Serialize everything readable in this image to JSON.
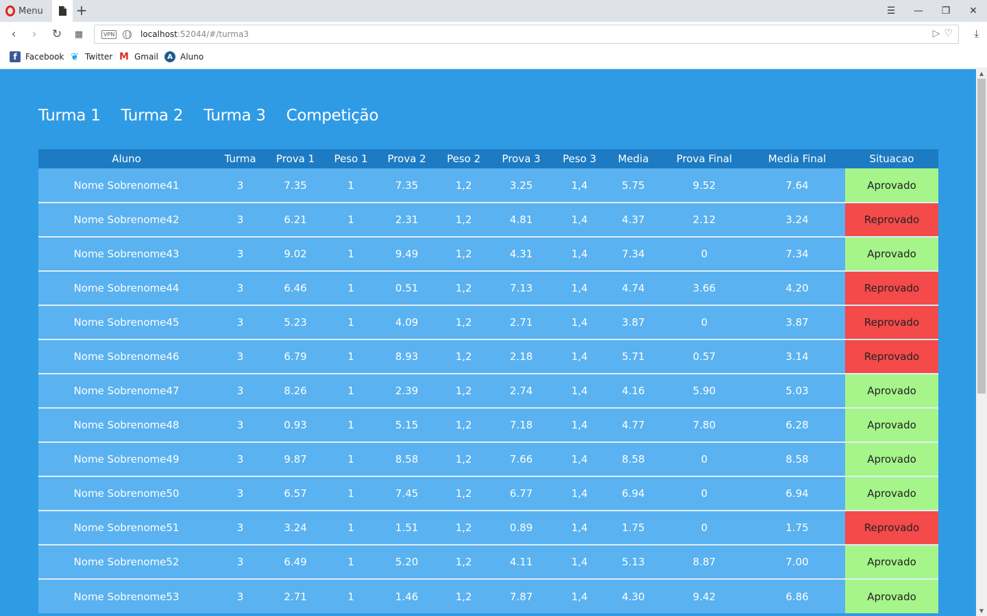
{
  "browser": {
    "menu_label": "Menu",
    "url_host": "localhost",
    "url_rest": ":52044/#/turma3",
    "vpn_label": "VPN",
    "bookmarks": [
      {
        "label": "Facebook",
        "icon": "facebook-icon"
      },
      {
        "label": "Twitter",
        "icon": "twitter-icon"
      },
      {
        "label": "Gmail",
        "icon": "gmail-icon"
      },
      {
        "label": "Aluno",
        "icon": "aluno-icon"
      }
    ]
  },
  "nav": {
    "items": [
      "Turma 1",
      "Turma 2",
      "Turma 3",
      "Competição"
    ]
  },
  "table": {
    "headers": [
      "Aluno",
      "Turma",
      "Prova 1",
      "Peso 1",
      "Prova 2",
      "Peso 2",
      "Prova 3",
      "Peso 3",
      "Media",
      "Prova Final",
      "Media Final",
      "Situacao"
    ],
    "rows": [
      [
        "Nome Sobrenome41",
        "3",
        "7.35",
        "1",
        "7.35",
        "1,2",
        "3.25",
        "1,4",
        "5.75",
        "9.52",
        "7.64",
        "Aprovado"
      ],
      [
        "Nome Sobrenome42",
        "3",
        "6.21",
        "1",
        "2.31",
        "1,2",
        "4.81",
        "1,4",
        "4.37",
        "2.12",
        "3.24",
        "Reprovado"
      ],
      [
        "Nome Sobrenome43",
        "3",
        "9.02",
        "1",
        "9.49",
        "1,2",
        "4.31",
        "1,4",
        "7.34",
        "0",
        "7.34",
        "Aprovado"
      ],
      [
        "Nome Sobrenome44",
        "3",
        "6.46",
        "1",
        "0.51",
        "1,2",
        "7.13",
        "1,4",
        "4.74",
        "3.66",
        "4.20",
        "Reprovado"
      ],
      [
        "Nome Sobrenome45",
        "3",
        "5.23",
        "1",
        "4.09",
        "1,2",
        "2.71",
        "1,4",
        "3.87",
        "0",
        "3.87",
        "Reprovado"
      ],
      [
        "Nome Sobrenome46",
        "3",
        "6.79",
        "1",
        "8.93",
        "1,2",
        "2.18",
        "1,4",
        "5.71",
        "0.57",
        "3.14",
        "Reprovado"
      ],
      [
        "Nome Sobrenome47",
        "3",
        "8.26",
        "1",
        "2.39",
        "1,2",
        "2.74",
        "1,4",
        "4.16",
        "5.90",
        "5.03",
        "Aprovado"
      ],
      [
        "Nome Sobrenome48",
        "3",
        "0.93",
        "1",
        "5.15",
        "1,2",
        "7.18",
        "1,4",
        "4.77",
        "7.80",
        "6.28",
        "Aprovado"
      ],
      [
        "Nome Sobrenome49",
        "3",
        "9.87",
        "1",
        "8.58",
        "1,2",
        "7.66",
        "1,4",
        "8.58",
        "0",
        "8.58",
        "Aprovado"
      ],
      [
        "Nome Sobrenome50",
        "3",
        "6.57",
        "1",
        "7.45",
        "1,2",
        "6.77",
        "1,4",
        "6.94",
        "0",
        "6.94",
        "Aprovado"
      ],
      [
        "Nome Sobrenome51",
        "3",
        "3.24",
        "1",
        "1.51",
        "1,2",
        "0.89",
        "1,4",
        "1.75",
        "0",
        "1.75",
        "Reprovado"
      ],
      [
        "Nome Sobrenome52",
        "3",
        "6.49",
        "1",
        "5.20",
        "1,2",
        "4.11",
        "1,4",
        "5.13",
        "8.87",
        "7.00",
        "Aprovado"
      ],
      [
        "Nome Sobrenome53",
        "3",
        "2.71",
        "1",
        "1.46",
        "1,2",
        "7.87",
        "1,4",
        "4.30",
        "9.42",
        "6.86",
        "Aprovado"
      ]
    ]
  },
  "colors": {
    "page_bg": "#2f9be4",
    "header_bg": "#1d7bc3",
    "row_bg": "#5ab2f0",
    "approved": "#a6f58a",
    "failed": "#f44a4a"
  }
}
